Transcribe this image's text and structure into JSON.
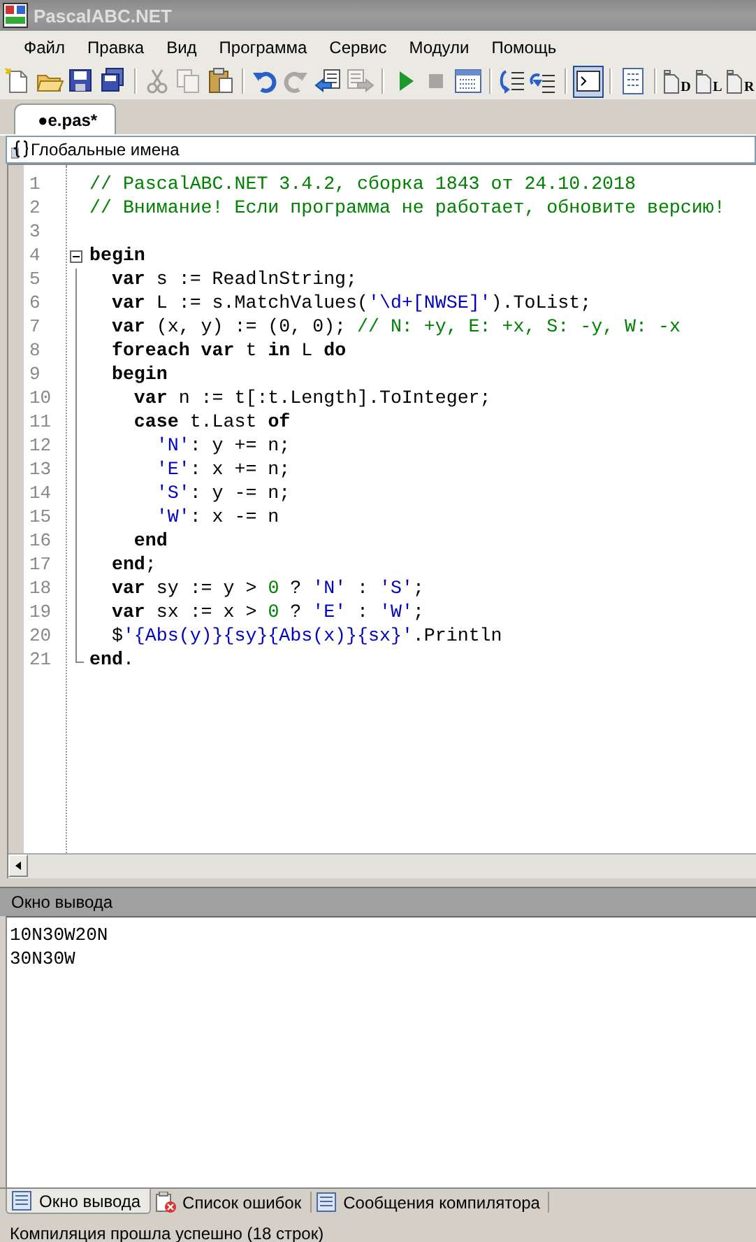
{
  "window": {
    "title": "PascalABC.NET"
  },
  "menu": [
    "Файл",
    "Правка",
    "Вид",
    "Программа",
    "Сервис",
    "Модули",
    "Помощь"
  ],
  "toolbar": [
    {
      "kind": "new",
      "disabled": false
    },
    {
      "kind": "open",
      "disabled": false
    },
    {
      "kind": "save",
      "disabled": false
    },
    {
      "kind": "saveall",
      "disabled": false
    },
    {
      "kind": "separator"
    },
    {
      "kind": "cut",
      "disabled": true
    },
    {
      "kind": "copy",
      "disabled": true
    },
    {
      "kind": "paste",
      "disabled": false
    },
    {
      "kind": "separator"
    },
    {
      "kind": "undo",
      "disabled": false
    },
    {
      "kind": "redo",
      "disabled": true
    },
    {
      "kind": "back",
      "disabled": false
    },
    {
      "kind": "forward",
      "disabled": true
    },
    {
      "kind": "separator"
    },
    {
      "kind": "run",
      "disabled": false
    },
    {
      "kind": "stop",
      "disabled": true
    },
    {
      "kind": "compile",
      "disabled": false
    },
    {
      "kind": "separator"
    },
    {
      "kind": "stepin",
      "disabled": false
    },
    {
      "kind": "stepover",
      "disabled": false
    },
    {
      "kind": "separator"
    },
    {
      "kind": "console",
      "disabled": false,
      "pressed": true
    },
    {
      "kind": "separator"
    },
    {
      "kind": "document",
      "disabled": false
    },
    {
      "kind": "separator"
    },
    {
      "kind": "template",
      "label": "D",
      "disabled": false
    },
    {
      "kind": "template",
      "label": "L",
      "disabled": false
    },
    {
      "kind": "template",
      "label": "R",
      "disabled": false
    }
  ],
  "tabs": [
    {
      "label": "●e.pas*",
      "selected": true
    }
  ],
  "scope_combo": {
    "value": "Глобальные имена"
  },
  "editor": {
    "lines": [
      {
        "number": "1",
        "tokens": [
          {
            "kind": "comment",
            "text": "// PascalABC.NET 3.4.2, сборка 1843 от 24.10.2018"
          }
        ]
      },
      {
        "number": "2",
        "tokens": [
          {
            "kind": "comment",
            "text": "// Внимание! Если программа не работает, обновите версию!"
          }
        ]
      },
      {
        "number": "3"
      },
      {
        "number": "4",
        "expanded": true,
        "tokens": [
          {
            "kind": "keyword",
            "text": "begin"
          }
        ]
      },
      {
        "number": "5",
        "tokens": [
          {
            "kind": "keyword",
            "text": "  var"
          },
          {
            "kind": "plain",
            "text": " s := ReadlnString;"
          }
        ]
      },
      {
        "number": "6",
        "tokens": [
          {
            "kind": "keyword",
            "text": "  var"
          },
          {
            "kind": "plain",
            "text": " L := s.MatchValues("
          },
          {
            "kind": "string",
            "text": "'\\d+[NWSE]'"
          },
          {
            "kind": "plain",
            "text": ").ToList;"
          }
        ]
      },
      {
        "number": "7",
        "tokens": [
          {
            "kind": "keyword",
            "text": "  var"
          },
          {
            "kind": "plain",
            "text": " (x, y) := (0, 0); "
          },
          {
            "kind": "comment",
            "text": "// N: +y, E: +x, S: -y, W: -x"
          }
        ]
      },
      {
        "number": "8",
        "tokens": [
          {
            "kind": "keyword",
            "text": "  foreach"
          },
          {
            "kind": "keyword",
            "text": " var"
          },
          {
            "kind": "plain",
            "text": " t "
          },
          {
            "kind": "keyword",
            "text": "in"
          },
          {
            "kind": "plain",
            "text": " L "
          },
          {
            "kind": "keyword",
            "text": "do"
          }
        ]
      },
      {
        "number": "9",
        "tokens": [
          {
            "kind": "keyword",
            "text": "  begin"
          }
        ]
      },
      {
        "number": "10",
        "tokens": [
          {
            "kind": "keyword",
            "text": "    var"
          },
          {
            "kind": "plain",
            "text": " n := t[:t.Length].ToInteger;"
          }
        ]
      },
      {
        "number": "11",
        "tokens": [
          {
            "kind": "keyword",
            "text": "    case"
          },
          {
            "kind": "plain",
            "text": " t.Last "
          },
          {
            "kind": "keyword",
            "text": "of"
          }
        ]
      },
      {
        "number": "12",
        "tokens": [
          {
            "kind": "string",
            "text": "      'N'"
          },
          {
            "kind": "plain",
            "text": ": y += n;"
          }
        ]
      },
      {
        "number": "13",
        "tokens": [
          {
            "kind": "string",
            "text": "      'E'"
          },
          {
            "kind": "plain",
            "text": ": x += n;"
          }
        ]
      },
      {
        "number": "14",
        "tokens": [
          {
            "kind": "string",
            "text": "      'S'"
          },
          {
            "kind": "plain",
            "text": ": y -= n;"
          }
        ]
      },
      {
        "number": "15",
        "tokens": [
          {
            "kind": "string",
            "text": "      'W'"
          },
          {
            "kind": "plain",
            "text": ": x -= n"
          }
        ]
      },
      {
        "number": "16",
        "tokens": [
          {
            "kind": "keyword",
            "text": "    end"
          }
        ]
      },
      {
        "number": "17",
        "tokens": [
          {
            "kind": "keyword",
            "text": "  end"
          },
          {
            "kind": "plain",
            "text": ";"
          }
        ]
      },
      {
        "number": "18",
        "tokens": [
          {
            "kind": "keyword",
            "text": "  var"
          },
          {
            "kind": "plain",
            "text": " sy := y > "
          },
          {
            "kind": "number",
            "text": "0"
          },
          {
            "kind": "plain",
            "text": " ? "
          },
          {
            "kind": "string",
            "text": "'N'"
          },
          {
            "kind": "plain",
            "text": " : "
          },
          {
            "kind": "string",
            "text": "'S'"
          },
          {
            "kind": "plain",
            "text": ";"
          }
        ]
      },
      {
        "number": "19",
        "tokens": [
          {
            "kind": "keyword",
            "text": "  var"
          },
          {
            "kind": "plain",
            "text": " sx := x > "
          },
          {
            "kind": "number",
            "text": "0"
          },
          {
            "kind": "plain",
            "text": " ? "
          },
          {
            "kind": "string",
            "text": "'E'"
          },
          {
            "kind": "plain",
            "text": " : "
          },
          {
            "kind": "string",
            "text": "'W'"
          },
          {
            "kind": "plain",
            "text": ";"
          }
        ]
      },
      {
        "number": "20",
        "tokens": [
          {
            "kind": "plain",
            "text": "  $"
          },
          {
            "kind": "string",
            "text": "'{Abs(y)}{sy}{Abs(x)}{sx}'"
          },
          {
            "kind": "plain",
            "text": ".Println"
          }
        ]
      },
      {
        "number": "21",
        "tokens": [
          {
            "kind": "keyword",
            "text": "end"
          },
          {
            "kind": "plain",
            "text": "."
          }
        ]
      }
    ]
  },
  "output": {
    "title": "Окно вывода",
    "lines": [
      "10N30W20N",
      "30N30W"
    ]
  },
  "bottom_tabs": [
    {
      "kind": "output",
      "label": "Окно вывода",
      "selected": true
    },
    {
      "kind": "errors",
      "label": "Список ошибок",
      "selected": false
    },
    {
      "kind": "messages",
      "label": "Сообщения компилятора",
      "selected": false
    }
  ],
  "status_bar": {
    "text": "Компиляция прошла успешно (18 строк)"
  }
}
